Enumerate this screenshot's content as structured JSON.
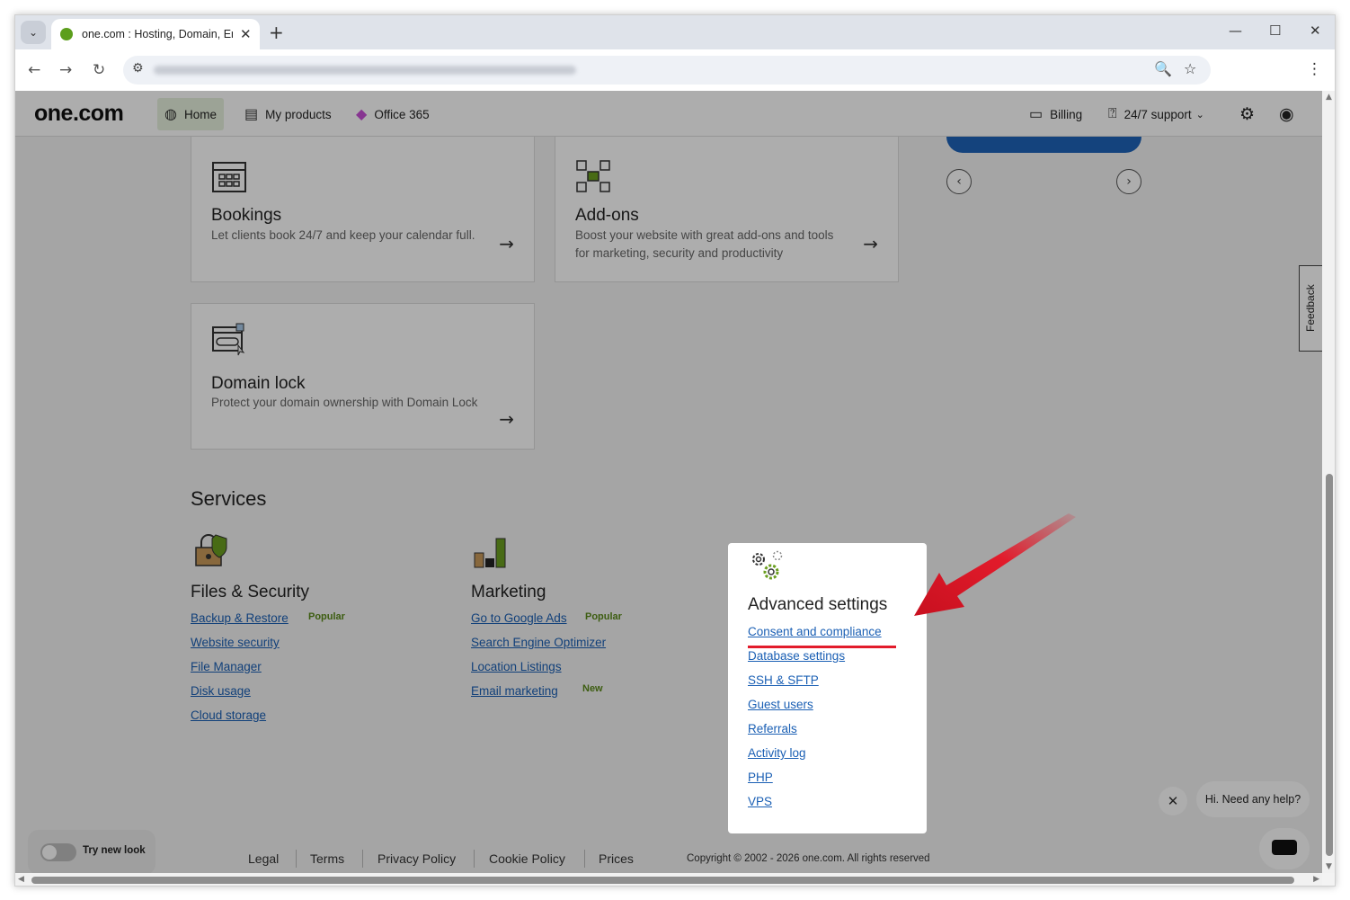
{
  "browser": {
    "tab_title": "one.com : Hosting, Domain, Em",
    "new_tab": "+",
    "close_tab": "✕",
    "minimize": "—",
    "maximize": "☐",
    "close_window": "✕"
  },
  "header": {
    "logo": "one.com",
    "nav": [
      {
        "label": "Home",
        "icon": "globe-icon"
      },
      {
        "label": "My products",
        "icon": "list-icon"
      },
      {
        "label": "Office 365",
        "icon": "office-icon"
      }
    ],
    "billing": "Billing",
    "support": "24/7 support"
  },
  "cards": [
    {
      "title": "Bookings",
      "desc": "Let clients book 24/7 and keep your calendar full."
    },
    {
      "title": "Add-ons",
      "desc": "Boost your website with great add-ons and tools for marketing, security and productivity"
    },
    {
      "title": "Domain lock",
      "desc": "Protect your domain ownership with Domain Lock"
    }
  ],
  "services": {
    "title": "Services",
    "files_security": {
      "title": "Files & Security",
      "links": [
        "Backup & Restore",
        "Website security",
        "File Manager",
        "Disk usage",
        "Cloud storage"
      ],
      "badge": "Popular"
    },
    "marketing": {
      "title": "Marketing",
      "links": [
        "Go to Google Ads",
        "Search Engine Optimizer",
        "Location Listings",
        "Email marketing"
      ],
      "badge_popular": "Popular",
      "badge_new": "New"
    },
    "advanced": {
      "title": "Advanced settings",
      "links": [
        "Consent and compliance",
        "Database settings",
        "SSH & SFTP",
        "Guest users",
        "Referrals",
        "Activity log",
        "PHP",
        "VPS"
      ]
    }
  },
  "feedback": "Feedback",
  "footer": {
    "links": [
      "Legal",
      "Terms",
      "Privacy Policy",
      "Cookie Policy",
      "Prices"
    ],
    "copyright": "Copyright © 2002 - 2026 one.com. All rights reserved"
  },
  "toggle_label": "Try new look",
  "chat": {
    "greeting": "Hi. Need any help?"
  },
  "colors": {
    "accent": "#1e63b8",
    "brand_green": "#5c9e1c",
    "highlight_red": "#e21b2b"
  }
}
